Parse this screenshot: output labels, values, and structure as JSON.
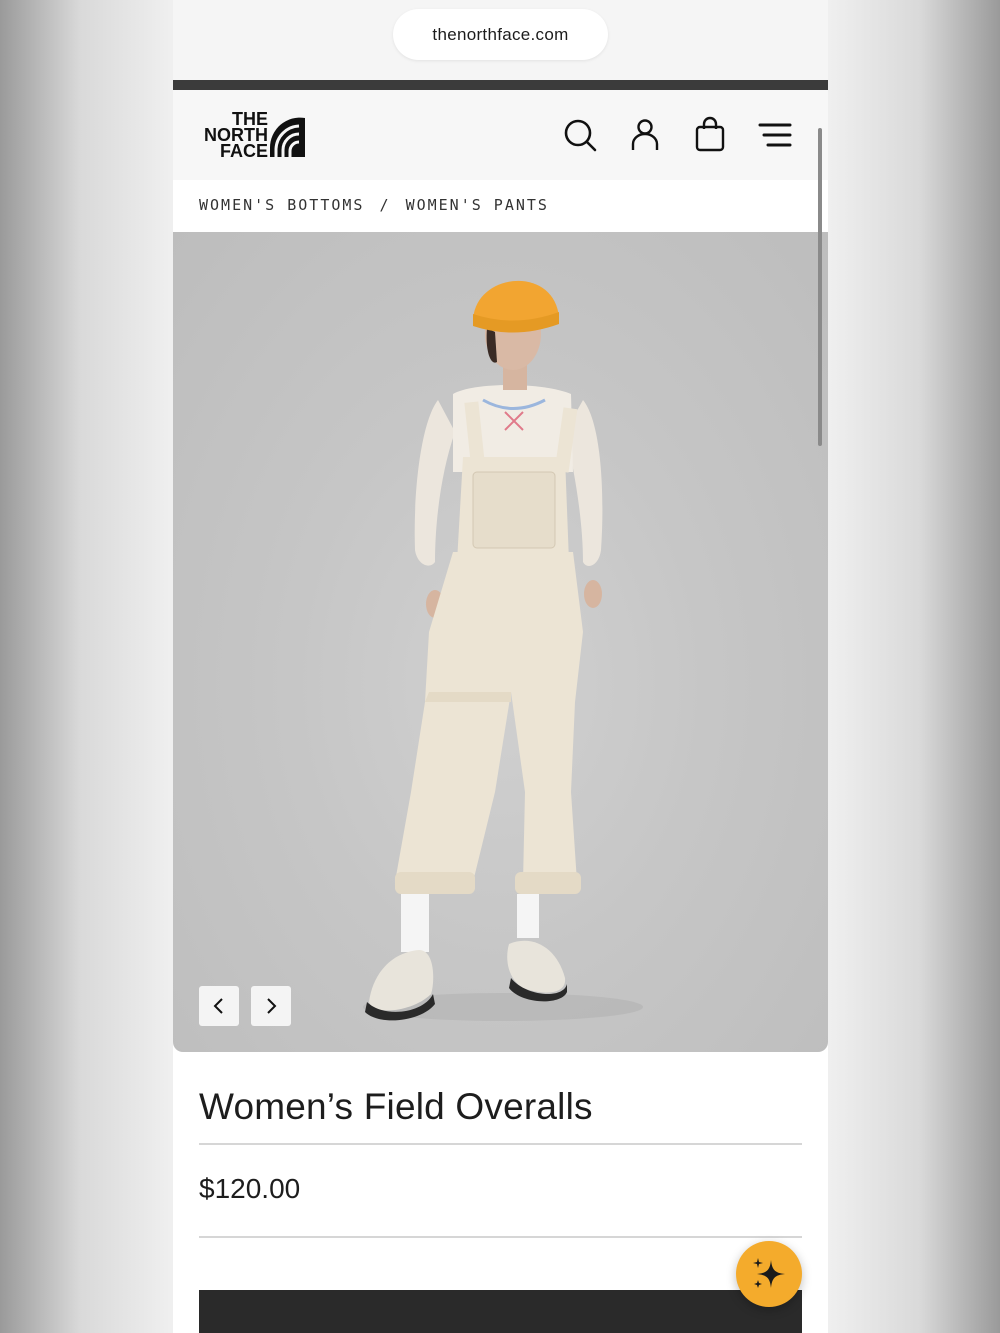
{
  "browser": {
    "url": "thenorthface.com"
  },
  "header": {
    "logo_lines": [
      "THE",
      "NORTH",
      "FACE"
    ],
    "icons": [
      "search-icon",
      "account-icon",
      "shopping-bag-icon",
      "menu-icon"
    ]
  },
  "breadcrumb": {
    "items": [
      "WOMEN'S BOTTOMS",
      "WOMEN'S PANTS"
    ],
    "separator": "/"
  },
  "gallery": {
    "prev_icon": "chevron-left-icon",
    "next_icon": "chevron-right-icon"
  },
  "product": {
    "name": "Women’s Field Overalls",
    "price": "$120.00"
  },
  "assistant": {
    "icon": "sparkle-icon",
    "color": "#f4ab2c"
  },
  "colors": {
    "brand_dark": "#2a2a2a",
    "hat": "#f2a531",
    "overalls": "#ece4d4"
  }
}
